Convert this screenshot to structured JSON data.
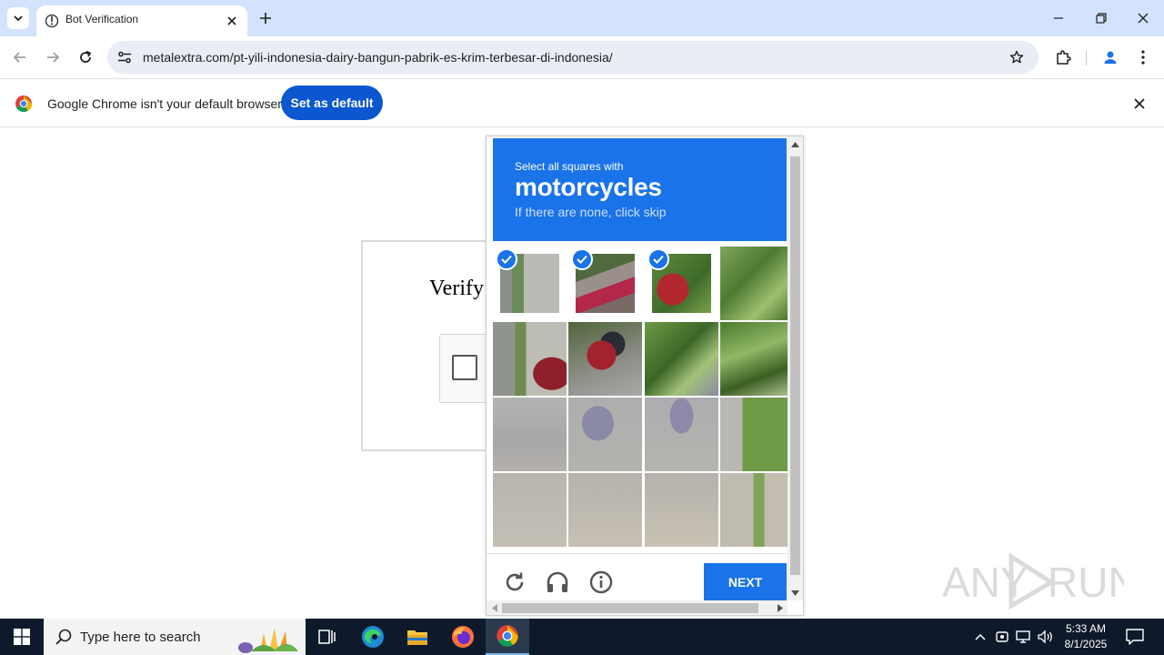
{
  "browser": {
    "tab_title": "Bot Verification",
    "url": "metalextra.com/pt-yili-indonesia-dairy-bangun-pabrik-es-krim-terbesar-di-indonesia/",
    "icons": [
      "tab-search-icon",
      "globe-icon",
      "close-icon",
      "plus-icon",
      "minimize-icon",
      "restore-icon",
      "back-icon",
      "forward-icon",
      "reload-icon",
      "site-info-icon",
      "star-icon",
      "extensions-icon",
      "profile-icon",
      "menu-icon"
    ]
  },
  "infobar": {
    "message": "Google Chrome isn't your default browser",
    "button_label": "Set as default"
  },
  "page": {
    "heading": "Verify"
  },
  "captcha": {
    "instruction_line1": "Select all squares with",
    "target": "motorcycles",
    "instruction_line3": "If there are none, click skip",
    "next_label": "NEXT",
    "selected_tiles": [
      0,
      1,
      2
    ],
    "accent_color": "#1a73e8"
  },
  "watermark": {
    "text_left": "ANY",
    "text_right": "RUN"
  },
  "taskbar": {
    "search_placeholder": "Type here to search",
    "time": "5:33 AM",
    "date": "8/1/2025"
  }
}
